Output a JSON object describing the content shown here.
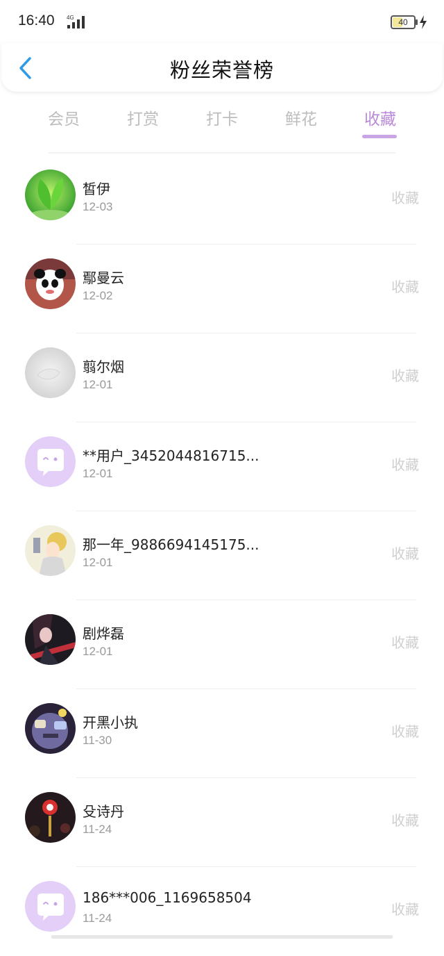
{
  "status": {
    "time": "16:40",
    "network": "4G",
    "battery": "40"
  },
  "header": {
    "title": "粉丝荣誉榜"
  },
  "tabs": [
    {
      "label": "会员"
    },
    {
      "label": "打赏"
    },
    {
      "label": "打卡"
    },
    {
      "label": "鲜花"
    },
    {
      "label": "收藏",
      "active": true
    }
  ],
  "colors": {
    "accent": "#b98ad8",
    "inactive_tab": "#bdbdbd",
    "default_avatar_bg": "#e3cff7"
  },
  "list": [
    {
      "name": "皙伊",
      "date": "12-03",
      "action": "收藏",
      "avatar": "leaf-photo"
    },
    {
      "name": "鄢曼云",
      "date": "12-02",
      "action": "收藏",
      "avatar": "panda-photo"
    },
    {
      "name": "翦尔烟",
      "date": "12-01",
      "action": "收藏",
      "avatar": "grey-photo"
    },
    {
      "name": "**用户_3452044816715...",
      "date": "12-01",
      "action": "收藏",
      "avatar": "default-chat-avatar"
    },
    {
      "name": "那一年_9886694145175...",
      "date": "12-01",
      "action": "收藏",
      "avatar": "anime-photo"
    },
    {
      "name": "剧烨磊",
      "date": "12-01",
      "action": "收藏",
      "avatar": "dark-anime-photo"
    },
    {
      "name": "开黑小执",
      "date": "11-30",
      "action": "收藏",
      "avatar": "game-photo"
    },
    {
      "name": "殳诗丹",
      "date": "11-24",
      "action": "收藏",
      "avatar": "red-fish-photo"
    },
    {
      "name": "186***006_1169658504",
      "date": "11-24",
      "action": "收藏",
      "avatar": "default-chat-avatar"
    }
  ]
}
